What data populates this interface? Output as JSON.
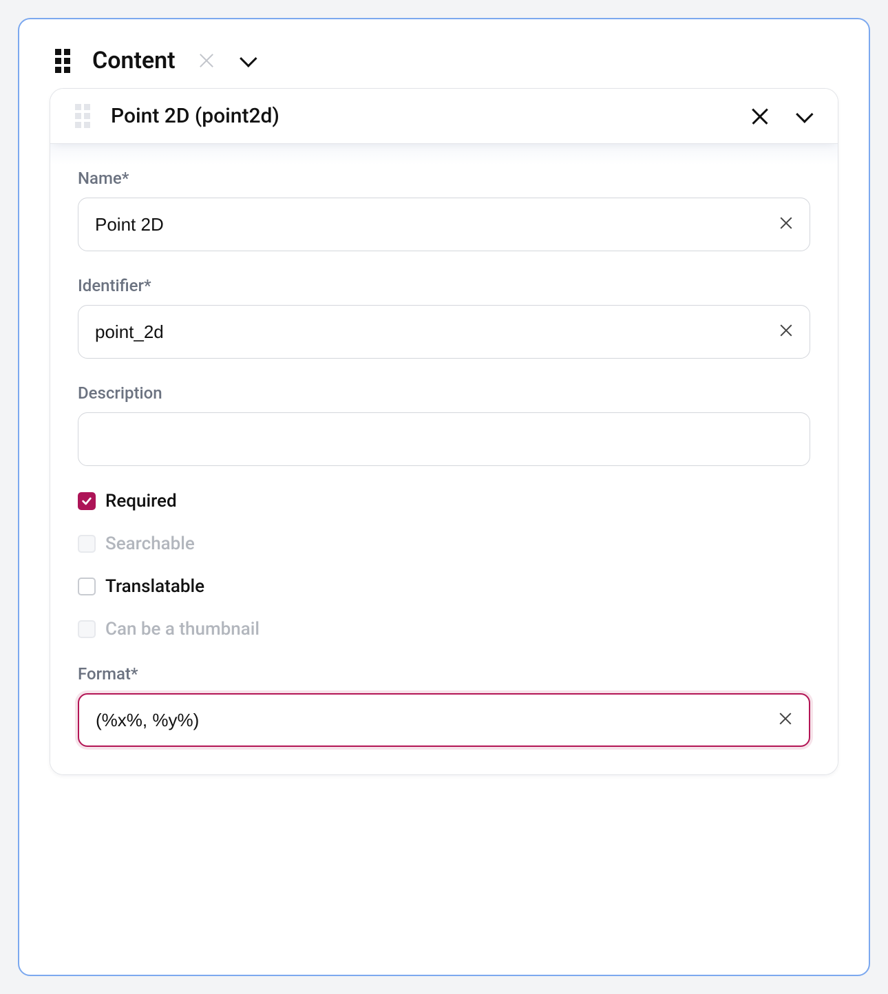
{
  "section": {
    "title": "Content"
  },
  "field": {
    "title": "Point 2D (point2d)",
    "labels": {
      "name": "Name*",
      "identifier": "Identifier*",
      "description": "Description",
      "required": "Required",
      "searchable": "Searchable",
      "translatable": "Translatable",
      "thumbnail": "Can be a thumbnail",
      "format": "Format*"
    },
    "values": {
      "name": "Point 2D",
      "identifier": "point_2d",
      "description": "",
      "format": "(%x%, %y%)"
    },
    "checks": {
      "required": true,
      "searchable": false,
      "translatable": false,
      "thumbnail": false
    },
    "disabled": {
      "searchable": true,
      "thumbnail": true
    }
  }
}
